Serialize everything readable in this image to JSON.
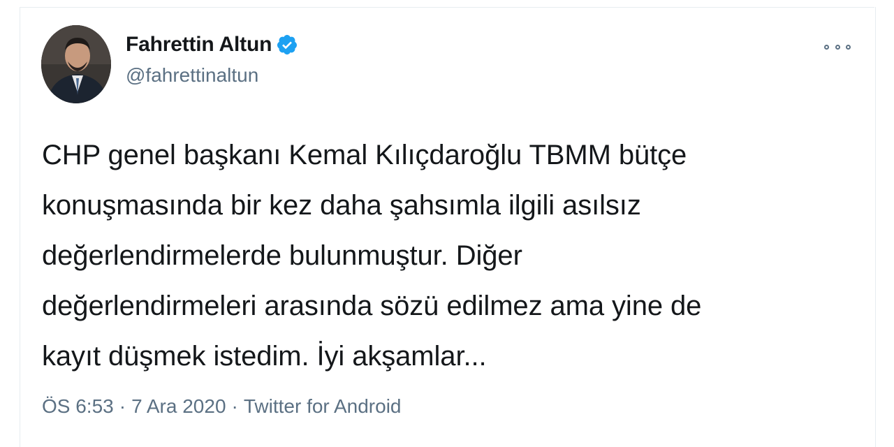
{
  "author": {
    "display_name": "Fahrettin Altun",
    "handle": "@fahrettinaltun",
    "verified": true
  },
  "tweet": {
    "lines": [
      "CHP genel başkanı Kemal Kılıçdaroğlu TBMM bütçe",
      "konuşmasında bir kez daha şahsımla ilgili asılsız",
      "değerlendirmelerde bulunmuştur. Diğer",
      "değerlendirmeleri arasında sözü edilmez ama yine de",
      "kayıt düşmek istedim. İyi akşamlar..."
    ]
  },
  "meta": {
    "time": "ÖS 6:53",
    "separator": "·",
    "date": "7 Ara 2020",
    "source": "Twitter for Android"
  },
  "icons": {
    "verified": "verified-badge-icon",
    "more": "more-options-icon"
  },
  "colors": {
    "verified_blue": "#1da1f2",
    "secondary_text": "#5b7083",
    "primary_text": "#14171a",
    "border": "#e6ecf0"
  }
}
